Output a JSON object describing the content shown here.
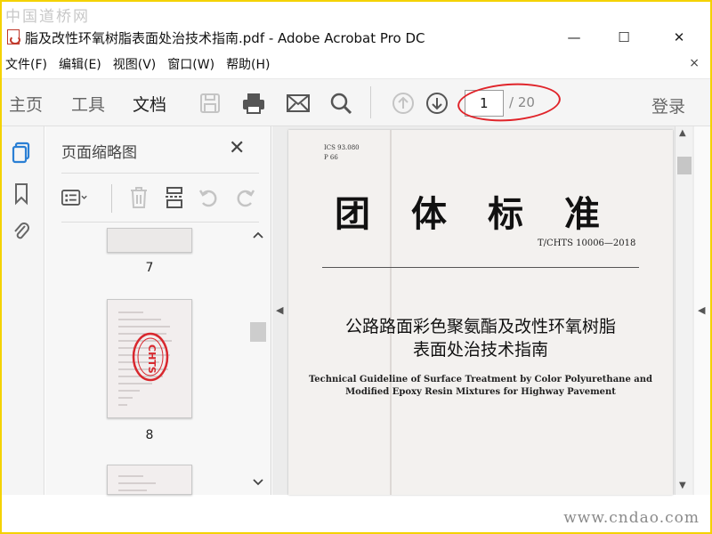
{
  "watermarks": {
    "top": "中国道桥网",
    "bottom": "www.cndao.com"
  },
  "window": {
    "title": "脂及改性环氧树脂表面处治技术指南.pdf - Adobe Acrobat Pro DC",
    "minimize": "—",
    "maximize": "☐",
    "close": "✕"
  },
  "menu": {
    "items": [
      "文件(F)",
      "编辑(E)",
      "视图(V)",
      "窗口(W)",
      "帮助(H)"
    ],
    "close": "×"
  },
  "toolbar": {
    "tabs": {
      "home": "主页",
      "tools": "工具",
      "document": "文档"
    },
    "current_page": "1",
    "total_pages": "/ 20",
    "login": "登录",
    "highlight_color": "#e0242a"
  },
  "thumbnails": {
    "title": "页面缩略图",
    "close": "✕",
    "pages": [
      {
        "number": "7"
      },
      {
        "number": "8",
        "stamp": "CHTS"
      }
    ]
  },
  "document": {
    "ics_line1": "ICS 93.080",
    "ics_line2": "P 66",
    "title": "团体标准",
    "code": "T/CHTS 10006—2018",
    "cn_title_line1": "公路路面彩色聚氨酯及改性环氧树脂",
    "cn_title_line2": "表面处治技术指南",
    "en_title_line1": "Technical Guideline of Surface Treatment by Color Polyurethane and",
    "en_title_line2": "Modified Epoxy Resin Mixtures for Highway Pavement"
  }
}
